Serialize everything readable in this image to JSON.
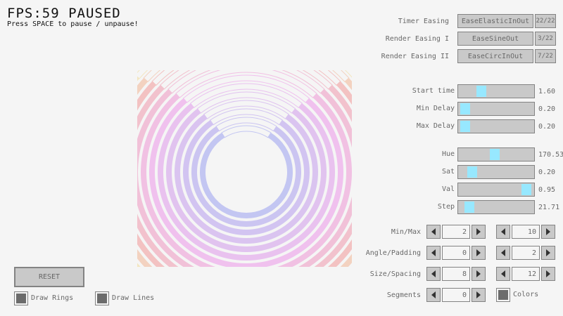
{
  "header": {
    "fps_text": "FPS:59 PAUSED",
    "hint": "Press SPACE to pause / unpause!"
  },
  "easing": [
    {
      "label": "Timer Easing",
      "value": "EaseElasticInOut",
      "count": "22/22"
    },
    {
      "label": "Render Easing I",
      "value": "EaseSineOut",
      "count": "3/22"
    },
    {
      "label": "Render Easing II",
      "value": "EaseCircInOut",
      "count": "7/22"
    }
  ],
  "timing_sliders": [
    {
      "label": "Start time",
      "value_text": "1.60",
      "fraction": 0.27
    },
    {
      "label": "Min Delay",
      "value_text": "0.20",
      "fraction": 0.02
    },
    {
      "label": "Max Delay",
      "value_text": "0.20",
      "fraction": 0.02
    }
  ],
  "color_sliders": [
    {
      "label": "Hue",
      "value_text": "170.53",
      "fraction": 0.47
    },
    {
      "label": "Sat",
      "value_text": "0.20",
      "fraction": 0.13
    },
    {
      "label": "Val",
      "value_text": "0.95",
      "fraction": 0.95
    },
    {
      "label": "Step",
      "value_text": "21.71",
      "fraction": 0.08
    }
  ],
  "spinners": [
    {
      "label": "Min/Max",
      "left": "2",
      "right": "10"
    },
    {
      "label": "Angle/Padding",
      "left": "0",
      "right": "2"
    },
    {
      "label": "Size/Spacing",
      "left": "8",
      "right": "12"
    },
    {
      "label": "Segments",
      "left": "0"
    }
  ],
  "colors_checkbox": {
    "label": "Colors",
    "checked": true
  },
  "bottom_left": {
    "reset_label": "RESET",
    "draw_rings_label": "Draw Rings",
    "draw_lines_label": "Draw Lines"
  },
  "ring_colors": {
    "inner": "#c3c6f2",
    "mid": "#f0c1ee",
    "outer": "#f3c2c0",
    "outermost": "#f3e6c0"
  }
}
